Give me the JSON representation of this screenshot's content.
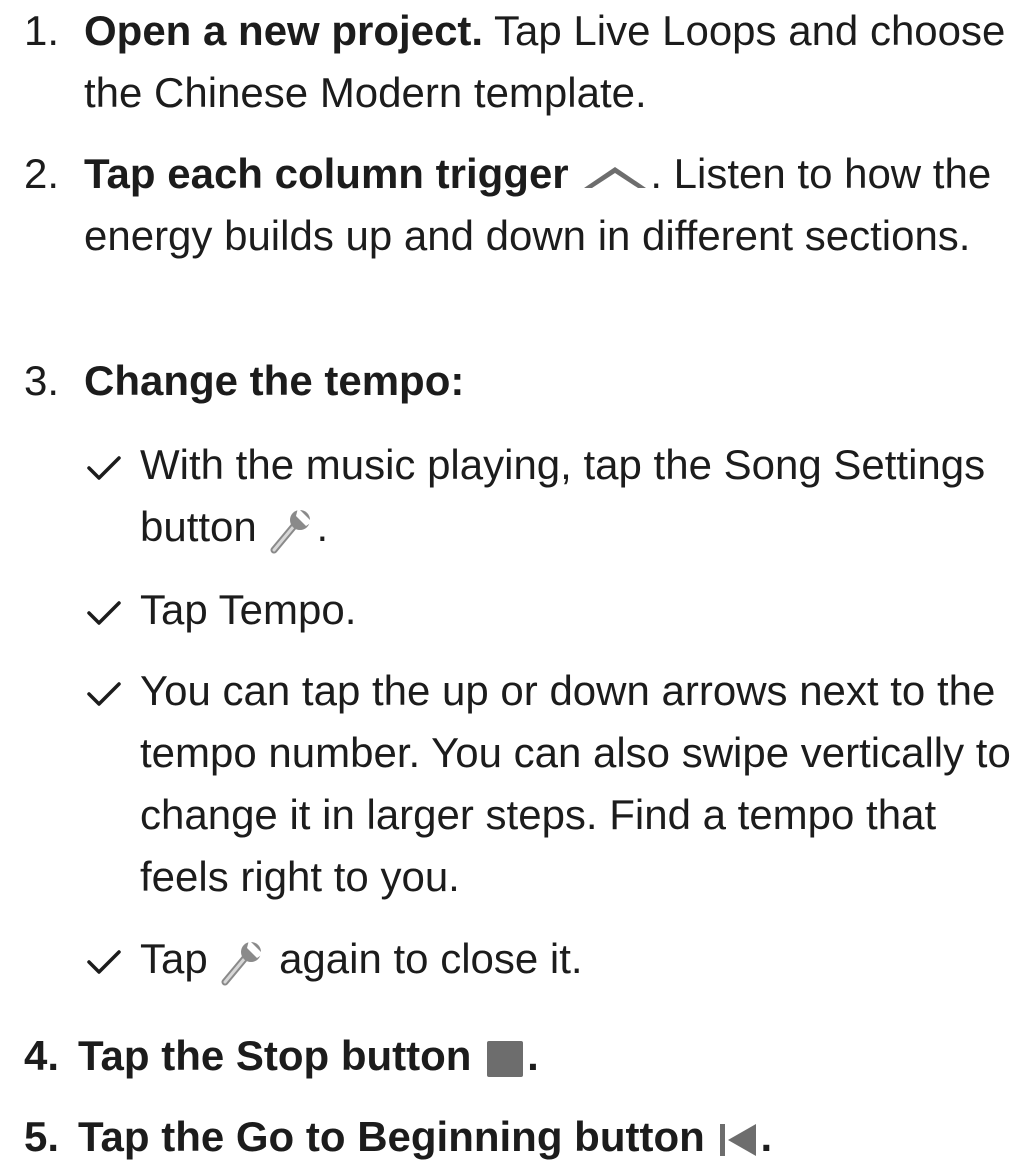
{
  "steps": [
    {
      "number": "1.",
      "title": "Open a new project.",
      "text": " Tap Live Loops and choose the Chinese Modern template."
    },
    {
      "number": "2.",
      "title": "Tap each column trigger",
      "icon": "column-trigger-icon",
      "text": ". Listen to how the energy builds up and down in different sections."
    },
    {
      "number": "3.",
      "title": "Change the tempo:",
      "substeps": [
        {
          "text_before": "With the music playing, tap the Song Settings button",
          "icon": "wrench-icon",
          "text_after": "."
        },
        {
          "text": "Tap Tempo."
        },
        {
          "text": "You can tap the up or down arrows next to the tempo number. You can also swipe vertically to change it in larger steps. Find a tempo that feels right to you."
        },
        {
          "text_before": "Tap",
          "icon": "wrench-icon",
          "text_after": "again to close it."
        }
      ]
    },
    {
      "number": "4.",
      "title": "Tap the Stop button",
      "icon": "stop-icon",
      "text": "."
    },
    {
      "number": "5.",
      "title": "Tap the Go to Beginning button",
      "icon": "go-to-beginning-icon",
      "text": "."
    }
  ],
  "colors": {
    "text": "#1c1c1c",
    "icon": "#6d6d6d"
  }
}
